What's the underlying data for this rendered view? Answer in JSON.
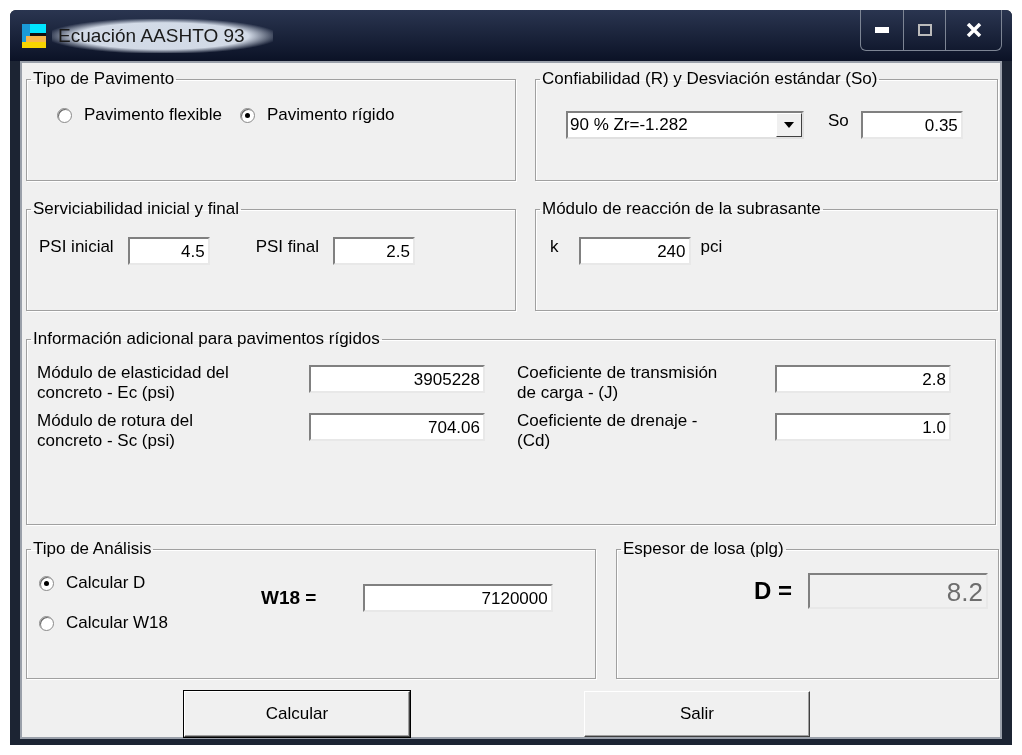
{
  "window": {
    "title": "Ecuación AASHTO 93"
  },
  "pavement_type": {
    "title": "Tipo de Pavimento",
    "options": [
      {
        "label": "Pavimento flexible",
        "selected": false
      },
      {
        "label": "Pavimento rígido",
        "selected": true
      }
    ]
  },
  "reliability": {
    "title": "Confiabilidad (R) y Desviación estándar (So)",
    "select_value": "90 % Zr=-1.282",
    "so_label": "So",
    "so_value": "0.35"
  },
  "serviceability": {
    "title": "Serviciabilidad inicial y final",
    "fields": [
      {
        "label": "PSI inicial",
        "value": "4.5"
      },
      {
        "label": "PSI final",
        "value": "2.5"
      }
    ]
  },
  "subgrade": {
    "title": "Módulo de reacción de la subrasante",
    "label": "k",
    "value": "240",
    "unit": "pci"
  },
  "rigid_info": {
    "title": "Información adicional para pavimentos rígidos",
    "fields": [
      {
        "label": "Módulo de elasticidad del concreto - Ec (psi)",
        "value": "3905228"
      },
      {
        "label": "Coeficiente de transmisión de carga - (J)",
        "value": "2.8"
      },
      {
        "label": "Módulo de rotura del concreto - Sc (psi)",
        "value": "704.06"
      },
      {
        "label": "Coeficiente de drenaje - (Cd)",
        "value": "1.0"
      }
    ]
  },
  "analysis": {
    "title": "Tipo de Análisis",
    "options": [
      {
        "label": "Calcular D",
        "selected": true
      },
      {
        "label": "Calcular W18",
        "selected": false
      }
    ],
    "w18_label": "W18 =",
    "w18_value": "7120000"
  },
  "thickness": {
    "title": "Espesor de losa (plg)",
    "label": "D =",
    "value": "8.2"
  },
  "buttons": [
    {
      "label": "Calcular"
    },
    {
      "label": "Salir"
    }
  ]
}
